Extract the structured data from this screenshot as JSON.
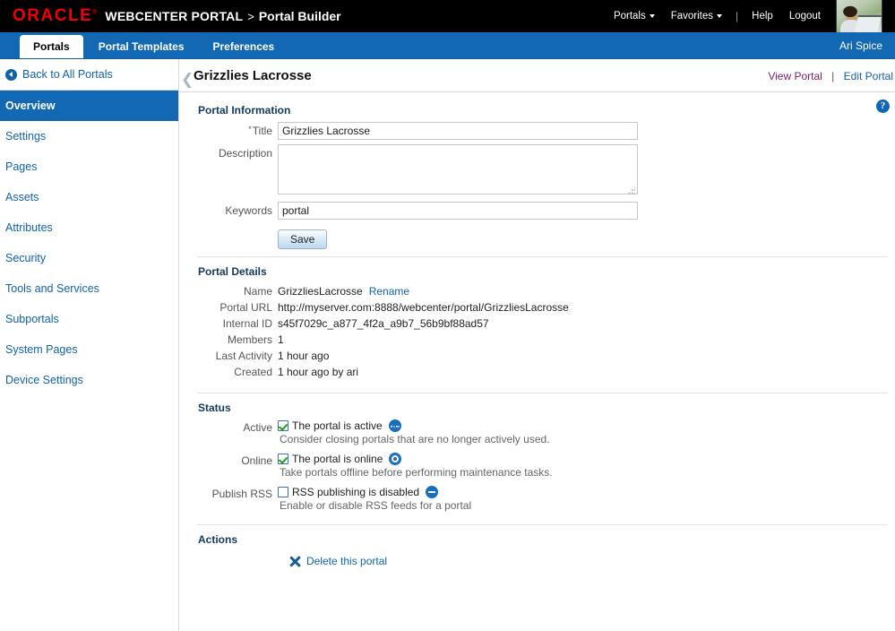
{
  "header": {
    "logo_text": "ORACLE",
    "app_name": "WEBCENTER PORTAL",
    "separator": ">",
    "app_section": "Portal Builder",
    "portals_menu": "Portals",
    "favorites_menu": "Favorites",
    "help_link": "Help",
    "logout_link": "Logout"
  },
  "tabs": {
    "items": [
      {
        "label": "Portals",
        "active": true
      },
      {
        "label": "Portal Templates",
        "active": false
      },
      {
        "label": "Preferences",
        "active": false
      }
    ],
    "user_name": "Ari Spice"
  },
  "sidebar": {
    "back_link": "Back to All Portals",
    "items": [
      {
        "label": "Overview",
        "active": true
      },
      {
        "label": "Settings",
        "active": false
      },
      {
        "label": "Pages",
        "active": false
      },
      {
        "label": "Assets",
        "active": false
      },
      {
        "label": "Attributes",
        "active": false
      },
      {
        "label": "Security",
        "active": false
      },
      {
        "label": "Tools and Services",
        "active": false
      },
      {
        "label": "Subportals",
        "active": false
      },
      {
        "label": "System Pages",
        "active": false
      },
      {
        "label": "Device Settings",
        "active": false
      }
    ]
  },
  "page": {
    "title": "Grizzlies Lacrosse",
    "view_portal": "View Portal",
    "links_separator": "|",
    "edit_portal": "Edit Portal",
    "help_glyph": "?"
  },
  "portal_information": {
    "section_title": "Portal Information",
    "title_label": "Title",
    "title_required_mark": "*",
    "title_value": "Grizzlies Lacrosse",
    "description_label": "Description",
    "description_value": "",
    "keywords_label": "Keywords",
    "keywords_value": "portal",
    "save_label": "Save"
  },
  "portal_details": {
    "section_title": "Portal Details",
    "rows": [
      {
        "label": "Name",
        "value": "GrizzliesLacrosse",
        "link": "Rename"
      },
      {
        "label": "Portal URL",
        "value": "http://myserver.com:8888/webcenter/portal/GrizzliesLacrosse",
        "link": ""
      },
      {
        "label": "Internal ID",
        "value": "s45f7029c_a877_4f2a_a9b7_56b9bf88ad57",
        "link": ""
      },
      {
        "label": "Members",
        "value": "1",
        "link": ""
      },
      {
        "label": "Last Activity",
        "value": "1 hour ago",
        "link": ""
      },
      {
        "label": "Created",
        "value": "1 hour ago by ari",
        "link": ""
      }
    ]
  },
  "status": {
    "section_title": "Status",
    "active": {
      "label": "Active",
      "checked": true,
      "text": "The portal is active",
      "hint": "Consider closing portals that are no longer actively used.",
      "icon": "pulse-icon"
    },
    "online": {
      "label": "Online",
      "checked": true,
      "text": "The portal is online",
      "hint": "Take portals offline before performing maintenance tasks.",
      "icon": "online-ring-icon"
    },
    "publish_rss": {
      "label": "Publish RSS",
      "checked": false,
      "text": "RSS publishing is disabled",
      "hint": "Enable or disable RSS feeds for a portal",
      "icon": "disabled-minus-icon"
    }
  },
  "actions": {
    "section_title": "Actions",
    "delete_label": "Delete this portal"
  },
  "colors": {
    "oracle_red": "#f00000",
    "brand_blue": "#1268b3",
    "link_blue": "#1163a8",
    "visited_link": "#7a1f6e",
    "section_heading": "#14395c",
    "check_green": "#18a018"
  }
}
